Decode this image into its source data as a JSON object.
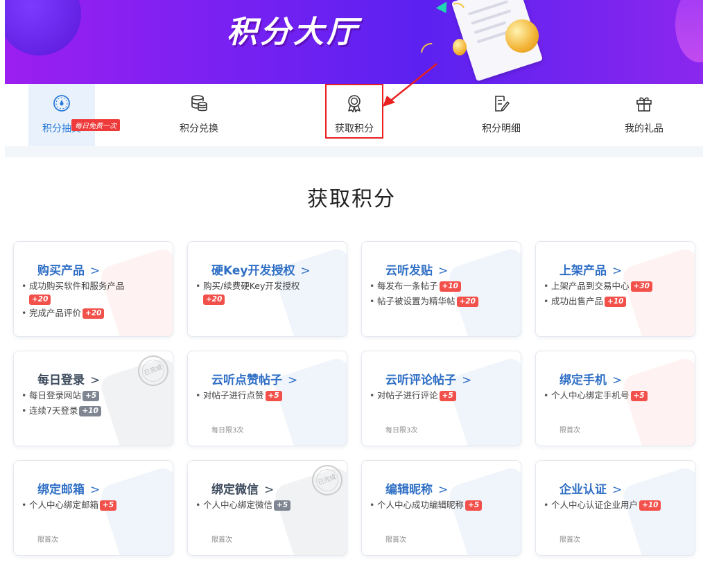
{
  "banner": {
    "title": "积分大厅"
  },
  "tabs": [
    {
      "label": "积分抽奖",
      "icon": "dial-icon",
      "badge": "每日免费一次",
      "active": true
    },
    {
      "label": "积分兑换",
      "icon": "coins-stack-icon"
    },
    {
      "label": "获取积分",
      "icon": "award-medal-icon",
      "highlighted": true
    },
    {
      "label": "积分明细",
      "icon": "document-edit-icon"
    },
    {
      "label": "我的礼品",
      "icon": "gift-icon"
    }
  ],
  "section_title": "获取积分",
  "cards": [
    {
      "title": "购买产品",
      "chevron": ">",
      "items": [
        {
          "text": "成功购买软件和服务产品",
          "points": "+20"
        },
        {
          "text": "完成产品评价",
          "points": "+20"
        }
      ]
    },
    {
      "title": "硬Key开发授权",
      "chevron": ">",
      "items": [
        {
          "text": "购买/续费硬Key开发授权",
          "points": "+20"
        }
      ]
    },
    {
      "title": "云听发贴",
      "chevron": ">",
      "items": [
        {
          "text": "每发布一条帖子",
          "points": "+10"
        },
        {
          "text": "帖子被设置为精华帖",
          "points": "+20"
        }
      ]
    },
    {
      "title": "上架产品",
      "chevron": ">",
      "items": [
        {
          "text": "上架产品到交易中心",
          "points": "+30"
        },
        {
          "text": "成功出售产品",
          "points": "+10"
        }
      ]
    },
    {
      "title": "每日登录",
      "chevron": ">",
      "stamp": "已完成",
      "items": [
        {
          "text": "每日登录网站",
          "points": "+5"
        },
        {
          "text": "连续7天登录",
          "points": "+10"
        }
      ]
    },
    {
      "title": "云听点赞帖子",
      "chevron": ">",
      "note": "每日限3次",
      "items": [
        {
          "text": "对帖子进行点赞",
          "points": "+5"
        }
      ]
    },
    {
      "title": "云听评论帖子",
      "chevron": ">",
      "note": "每日限3次",
      "items": [
        {
          "text": "对帖子进行评论",
          "points": "+5"
        }
      ]
    },
    {
      "title": "绑定手机",
      "chevron": ">",
      "note": "限首次",
      "items": [
        {
          "text": "个人中心绑定手机号",
          "points": "+5"
        }
      ]
    },
    {
      "title": "绑定邮箱",
      "chevron": ">",
      "note": "限首次",
      "items": [
        {
          "text": "个人中心绑定邮箱",
          "points": "+5"
        }
      ]
    },
    {
      "title": "绑定微信",
      "chevron": ">",
      "note": "限首次",
      "stamp": "已完成",
      "items": [
        {
          "text": "个人中心绑定微信",
          "points": "+5"
        }
      ]
    },
    {
      "title": "编辑昵称",
      "chevron": ">",
      "note": "限首次",
      "items": [
        {
          "text": "个人中心成功编辑昵称",
          "points": "+5"
        }
      ]
    },
    {
      "title": "企业认证",
      "chevron": ">",
      "note": "限首次",
      "items": [
        {
          "text": "个人中心认证企业用户",
          "points": "+10"
        }
      ]
    }
  ],
  "colors": {
    "accent_blue": "#2f6fc5",
    "points_red": "#f2504a",
    "points_gray": "#7f8692",
    "highlight_red": "#e82020",
    "banner_purple": "#7a21f2"
  }
}
